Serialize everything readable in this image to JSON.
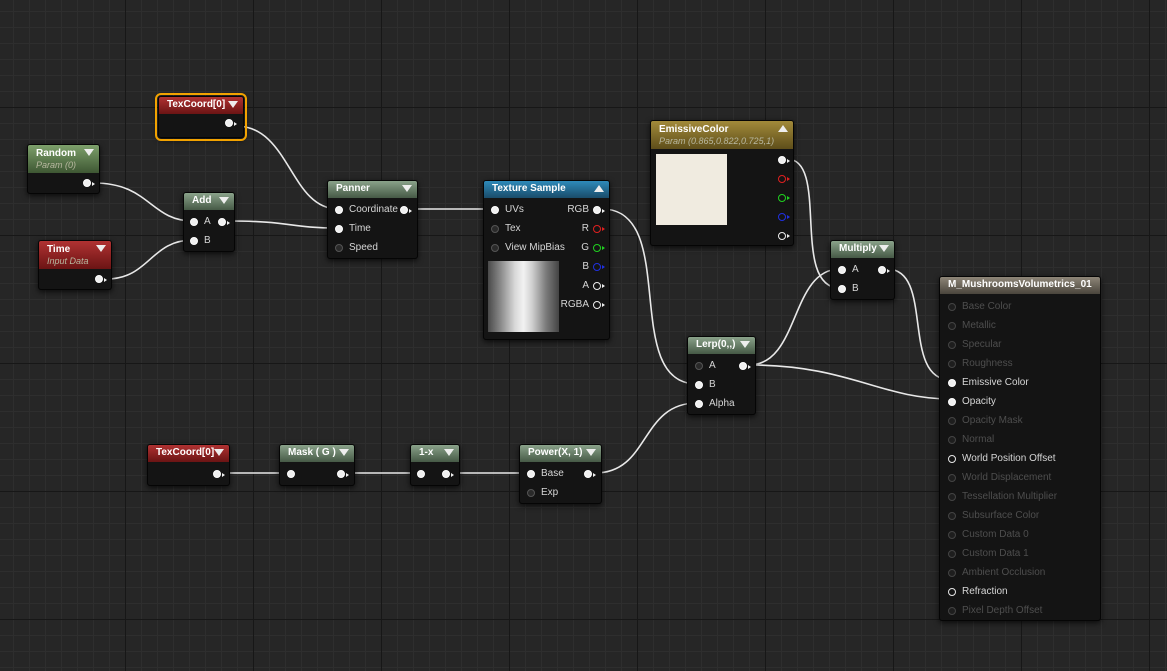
{
  "nodes": {
    "texcoord_top": {
      "title": "TexCoord[0]"
    },
    "random": {
      "title": "Random",
      "subtitle": "Param (0)"
    },
    "time": {
      "title": "Time",
      "subtitle": "Input Data"
    },
    "add": {
      "title": "Add",
      "inputs": [
        "A",
        "B"
      ]
    },
    "panner": {
      "title": "Panner",
      "inputs": [
        "Coordinate",
        "Time",
        "Speed"
      ]
    },
    "texture_sample": {
      "title": "Texture Sample",
      "inputs": [
        "UVs",
        "Tex",
        "View MipBias"
      ],
      "outputs": [
        "RGB",
        "R",
        "G",
        "B",
        "A",
        "RGBA"
      ]
    },
    "emissive": {
      "title": "EmissiveColor",
      "subtitle": "Param (0.865,0.822,0.725,1)",
      "swatch_color": "#f0ebe0"
    },
    "multiply": {
      "title": "Multiply",
      "inputs": [
        "A",
        "B"
      ]
    },
    "lerp": {
      "title": "Lerp(0,,)",
      "inputs": [
        "A",
        "B",
        "Alpha"
      ]
    },
    "texcoord_bottom": {
      "title": "TexCoord[0]"
    },
    "mask": {
      "title": "Mask ( G )"
    },
    "one_minus": {
      "title": "1-x"
    },
    "power": {
      "title": "Power(X, 1)",
      "inputs": [
        "Base",
        "Exp"
      ]
    },
    "material": {
      "title": "M_MushroomsVolumetrics_01",
      "inputs": [
        {
          "label": "Base Color",
          "active": false
        },
        {
          "label": "Metallic",
          "active": false
        },
        {
          "label": "Specular",
          "active": false
        },
        {
          "label": "Roughness",
          "active": false
        },
        {
          "label": "Emissive Color",
          "active": true
        },
        {
          "label": "Opacity",
          "active": true
        },
        {
          "label": "Opacity Mask",
          "active": false
        },
        {
          "label": "Normal",
          "active": false
        },
        {
          "label": "World Position Offset",
          "active": true
        },
        {
          "label": "World Displacement",
          "active": false
        },
        {
          "label": "Tessellation Multiplier",
          "active": false
        },
        {
          "label": "Subsurface Color",
          "active": false
        },
        {
          "label": "Custom Data 0",
          "active": false
        },
        {
          "label": "Custom Data 1",
          "active": false
        },
        {
          "label": "Ambient Occlusion",
          "active": false
        },
        {
          "label": "Refraction",
          "active": true
        },
        {
          "label": "Pixel Depth Offset",
          "active": false
        }
      ]
    }
  },
  "colors": {
    "graph_background": "#262626",
    "wire": "#e8e8e8",
    "selection": "#f2a200"
  }
}
